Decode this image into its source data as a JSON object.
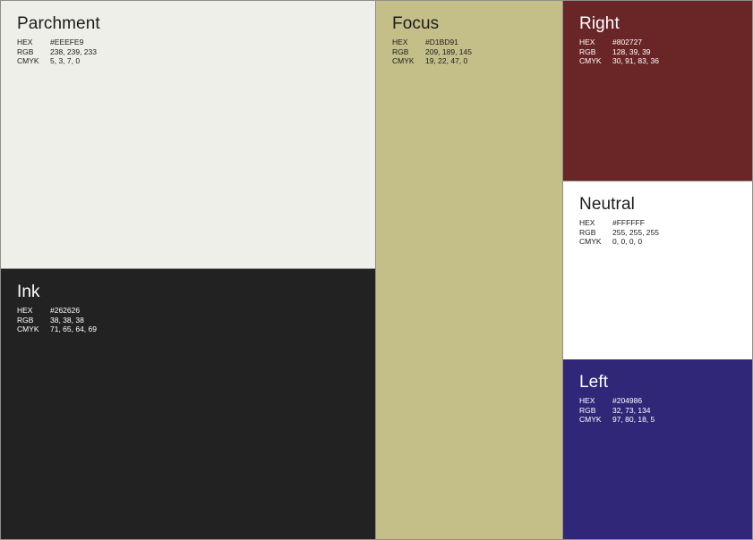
{
  "swatches": {
    "parchment": {
      "name": "Parchment",
      "bg": "#EEEFE9",
      "fg": "#1c1c1c",
      "hex_label": "HEX",
      "hex": "#EEEFE9",
      "rgb_label": "RGB",
      "rgb": "238, 239, 233",
      "cmyk_label": "CMYK",
      "cmyk": "5, 3, 7, 0"
    },
    "ink": {
      "name": "Ink",
      "bg": "#262626",
      "fg": "#ffffff",
      "hex_label": "HEX",
      "hex": "#262626",
      "rgb_label": "RGB",
      "rgb": "38, 38, 38",
      "cmyk_label": "CMYK",
      "cmyk": "71, 65, 64, 69"
    },
    "focus": {
      "name": "Focus",
      "bg": "#D1BD91",
      "fg": "#1c1c1c",
      "hex_label": "HEX",
      "hex": "#D1BD91",
      "rgb_label": "RGB",
      "rgb": "209, 189, 145",
      "cmyk_label": "CMYK",
      "cmyk": "19, 22, 47, 0"
    },
    "right": {
      "name": "Right",
      "bg": "#802727",
      "fg": "#ffffff",
      "hex_label": "HEX",
      "hex": "#802727",
      "rgb_label": "RGB",
      "rgb": "128, 39, 39",
      "cmyk_label": "CMYK",
      "cmyk": "30, 91, 83, 36"
    },
    "neutral": {
      "name": "Neutral",
      "bg": "#FFFFFF",
      "fg": "#1c1c1c",
      "hex_label": "HEX",
      "hex": "#FFFFFF",
      "rgb_label": "RGB",
      "rgb": "255, 255, 255",
      "cmyk_label": "CMYK",
      "cmyk": "0, 0, 0, 0"
    },
    "left": {
      "name": "Left",
      "bg": "#204986",
      "fg": "#ffffff",
      "hex_label": "HEX",
      "hex": "#204986",
      "rgb_label": "RGB",
      "rgb": "32, 73, 134",
      "cmyk_label": "CMYK",
      "cmyk": "97, 80, 18, 5"
    }
  },
  "display_colors": {
    "ink": "#222222",
    "focus": "#C4BE88",
    "right": "#6A2627",
    "left": "#302779"
  }
}
